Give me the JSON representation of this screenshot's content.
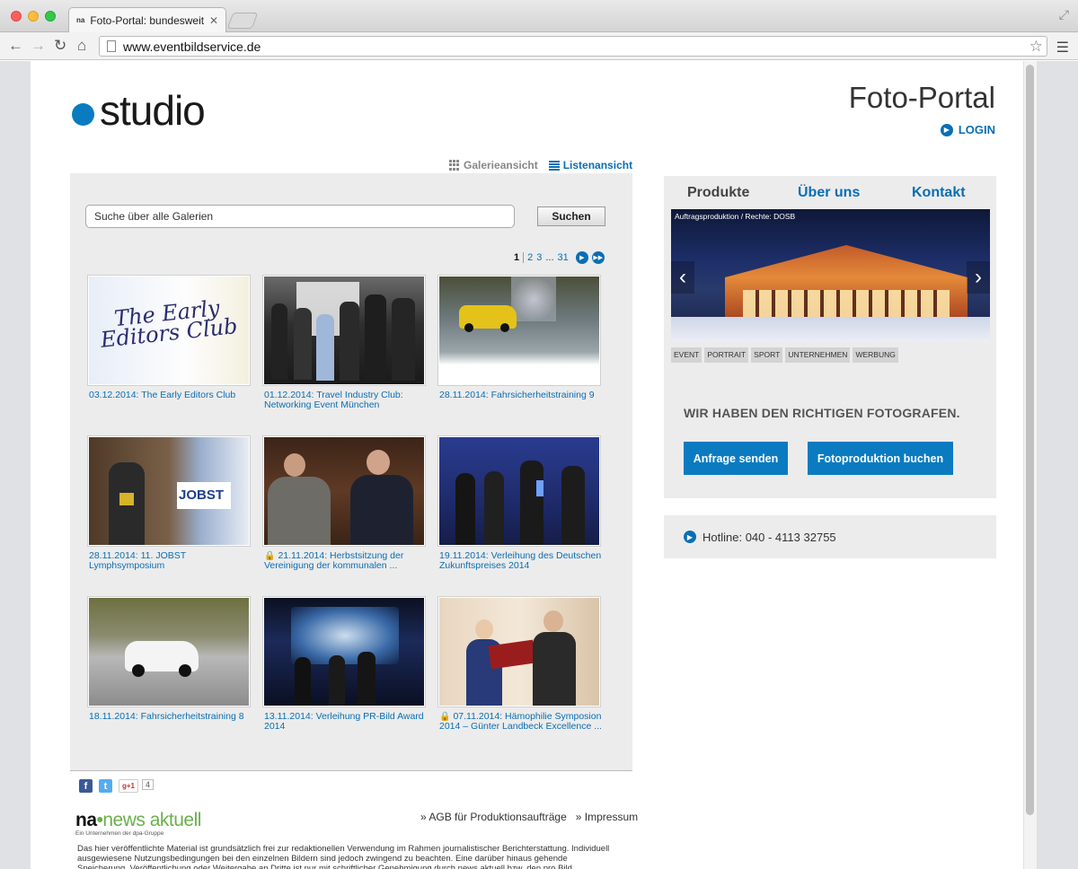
{
  "browser": {
    "tab_favicon": "na",
    "tab_title": "Foto-Portal: bundesweit Fo",
    "url": "www.eventbildservice.de"
  },
  "header": {
    "logo_text": "studio",
    "portal_title": "Foto-Portal",
    "login_label": "LOGIN"
  },
  "view_toggle": {
    "gallery": "Galerieansicht",
    "list": "Listenansicht"
  },
  "search": {
    "placeholder": "Suche über alle Galerien",
    "button": "Suchen"
  },
  "pagination": {
    "current": "1",
    "pages": [
      "2",
      "3"
    ],
    "dots": "...",
    "last": "31"
  },
  "galleries": [
    {
      "caption": "03.12.2014: The Early Editors Club",
      "locked": false
    },
    {
      "caption": "01.12.2014: Travel Industry Club: Networking Event München",
      "locked": false
    },
    {
      "caption": "28.11.2014: Fahrsicherheitstraining 9",
      "locked": false
    },
    {
      "caption": "28.11.2014: 11. JOBST Lymphsymposium",
      "locked": false
    },
    {
      "caption": "21.11.2014: Herbstsitzung der Vereinigung der kommunalen ...",
      "locked": true
    },
    {
      "caption": "19.11.2014: Verleihung des Deutschen Zukunftspreises 2014",
      "locked": false
    },
    {
      "caption": "18.11.2014: Fahrsicherheitstraining 8",
      "locked": false
    },
    {
      "caption": "13.11.2014: Verleihung PR-Bild Award 2014",
      "locked": false
    },
    {
      "caption": "07.11.2014: Hämophilie Symposion 2014 – Günter Landbeck Excellence ...",
      "locked": true
    }
  ],
  "thumb_texts": {
    "early_editors": "The Early Editors Club",
    "jobst": "JOBST"
  },
  "share": {
    "facebook": "f",
    "twitter": "t",
    "gplus": "g+1",
    "gplus_count": "4"
  },
  "right_nav": {
    "products": "Produkte",
    "about": "Über uns",
    "contact": "Kontakt"
  },
  "slider": {
    "caption": "Auftragsproduktion / Rechte: DOSB",
    "prev": "‹",
    "next": "›"
  },
  "categories": [
    "EVENT",
    "PORTRAIT",
    "SPORT",
    "UNTERNEHMEN",
    "WERBUNG"
  ],
  "claim": "WIR HABEN DEN RICHTIGEN FOTOGRAFEN.",
  "cta": {
    "request": "Anfrage senden",
    "book": "Fotoproduktion buchen"
  },
  "hotline": "Hotline: 040 - 4113 32755",
  "footer": {
    "na_prefix": "na",
    "na_brand": "news aktuell",
    "na_sub": "Ein Unternehmen der dpa-Gruppe",
    "links": [
      "AGB für Produktionsaufträge",
      "Impressum"
    ],
    "disclaimer": "Das hier veröffentlichte Material ist grundsätzlich frei zur redaktionellen Verwendung im Rahmen journalistischer Berichterstattung. Individuell ausgewiesene Nutzungsbedingungen bei den einzelnen Bildern sind jedoch zwingend zu beachten. Eine darüber hinaus gehende Speicherung, Veröffentlichung oder Weitergabe an Dritte ist nur mit schriftlicher Genehmigung durch news aktuell bzw. den pro Bild ausgewiesenen Auftraggeber"
  }
}
